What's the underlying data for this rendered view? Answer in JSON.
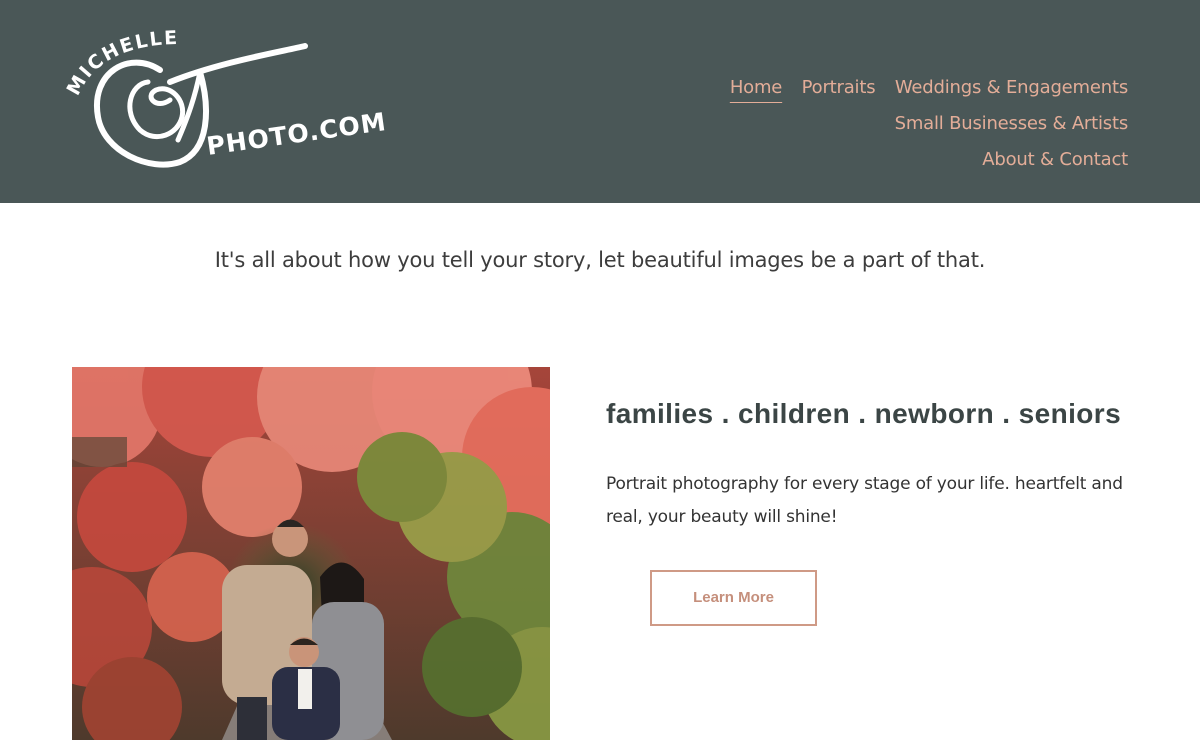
{
  "logo": {
    "top_text": "MICHELLE",
    "letter": "F",
    "bottom_text": "PHOTO.COM"
  },
  "nav": {
    "items": [
      {
        "label": "Home",
        "active": true
      },
      {
        "label": "Portraits",
        "active": false
      },
      {
        "label": "Weddings & Engagements",
        "active": false
      },
      {
        "label": "Small Businesses & Artists",
        "active": false
      },
      {
        "label": "About & Contact",
        "active": false
      }
    ]
  },
  "tagline": "It's all about how you tell your story, let beautiful images be a part of that.",
  "section": {
    "heading": "families . children . newborn . seniors",
    "body": "Portrait photography for every stage of your life. heartfelt and real, your beauty will shine!",
    "button_label": "Learn More"
  },
  "colors": {
    "header_bg": "#4a5757",
    "nav_link": "#e3ad98",
    "button_border": "#cf9a86",
    "button_text": "#c58f7c"
  }
}
